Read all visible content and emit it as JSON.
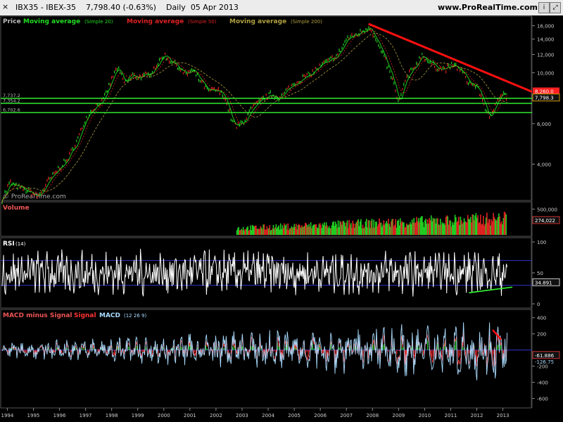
{
  "header": {
    "close_glyph": "×",
    "title": "IBX35 - IBEX-35",
    "last_price": "7,798.40",
    "change": "(-0.63%)",
    "period": "Daily",
    "date": "05 Apr 2013",
    "site": "www.ProRealTime.com",
    "btn_info": "i",
    "btn_expand": "⤢"
  },
  "price_panel": {
    "legend_price": "Price",
    "legend_ma20": "Moving average",
    "legend_ma20_params": "(Simple 20)",
    "legend_ma50": "Moving average",
    "legend_ma50_params": "(Simple 50)",
    "legend_ma200": "Moving average",
    "legend_ma200_params": "(Simple 200)",
    "watermark": "© ProRealTime.com",
    "level_labels": [
      "7,737.2",
      "7,354.2",
      "6,702.6"
    ],
    "last_tag_ma": "8,260.0",
    "last_tag_price": "7,798.3",
    "y_ticks": [
      "16,000",
      "14,000",
      "12,000",
      "10,000",
      "8,000",
      "6,000",
      "4,000"
    ]
  },
  "volume_panel": {
    "title": "Volume",
    "y_ticks": [
      "500,000"
    ],
    "last_tag": "274,022"
  },
  "rsi_panel": {
    "title": "RSI",
    "params": "(14)",
    "y_ticks": [
      "100",
      "50",
      "0"
    ],
    "last_tag": "34.891"
  },
  "macd_panel": {
    "title_hist": "MACD minus Signal",
    "title_signal": "Signal",
    "title_macd": "MACD",
    "params": "(12 26 9)",
    "y_ticks": [
      "400",
      "200",
      "-200",
      "-400",
      "-600"
    ],
    "last_tag_1": "-61.886",
    "last_tag_2": "-126.75"
  },
  "x_axis": {
    "labels": [
      "1994",
      "1995",
      "1996",
      "1997",
      "1998",
      "1999",
      "2000",
      "2001",
      "2002",
      "2003",
      "2004",
      "2005",
      "2006",
      "2007",
      "2008",
      "2009",
      "2010",
      "2011",
      "2012",
      "2013"
    ]
  },
  "colors": {
    "price_up": "#22cc22",
    "price_down": "#dd2222",
    "ma20": "#22dd22",
    "ma50": "#dd2222",
    "ma200": "#b0a040",
    "trendline": "#ff1010",
    "support": "#33ff33",
    "rsi": "#ffffff",
    "rsi_bands": "#3333cc",
    "macd": "#aaddff",
    "signal": "#ff4444"
  },
  "chart_data": [
    {
      "type": "line",
      "name": "price",
      "x": [
        1993.9,
        1994.2,
        1994.6,
        1995.0,
        1995.3,
        1995.7,
        1996.0,
        1996.4,
        1996.8,
        1997.1,
        1997.5,
        1997.8,
        1998.0,
        1998.3,
        1998.6,
        1998.9,
        1999.1,
        1999.5,
        1999.9,
        2000.1,
        2000.3,
        2000.6,
        2000.9,
        2001.2,
        2001.5,
        2001.8,
        2002.1,
        2002.4,
        2002.7,
        2002.9,
        2003.2,
        2003.5,
        2003.9,
        2004.2,
        2004.6,
        2004.9,
        2005.3,
        2005.7,
        2006.0,
        2006.4,
        2006.8,
        2007.1,
        2007.5,
        2007.8,
        2008.0,
        2008.3,
        2008.6,
        2008.9,
        2009.1,
        2009.4,
        2009.7,
        2010.0,
        2010.3,
        2010.6,
        2010.9,
        2011.2,
        2011.5,
        2011.8,
        2012.1,
        2012.4,
        2012.6,
        2012.9,
        2013.1,
        2013.26
      ],
      "values": [
        2800,
        3300,
        3150,
        3000,
        2900,
        3400,
        3750,
        4200,
        5100,
        6300,
        7200,
        7600,
        8800,
        10500,
        9000,
        9800,
        9500,
        9800,
        11000,
        12000,
        11400,
        10800,
        9800,
        10200,
        9200,
        8300,
        8400,
        8000,
        6200,
        5800,
        6200,
        7000,
        7700,
        8000,
        7800,
        8600,
        9300,
        9800,
        10500,
        11200,
        12000,
        14000,
        14700,
        15400,
        15800,
        13300,
        11200,
        9000,
        7300,
        9500,
        10500,
        12000,
        11000,
        10500,
        10400,
        10800,
        10200,
        9000,
        8700,
        7200,
        6200,
        7800,
        8200,
        7798
      ],
      "ylim": [
        2800,
        17000
      ],
      "ylog": true
    },
    {
      "type": "line",
      "name": "RSI (14)",
      "ylim": [
        0,
        100
      ],
      "bands": [
        70,
        30
      ],
      "last": 34.891
    },
    {
      "type": "bar",
      "name": "Volume",
      "last": 274022
    },
    {
      "type": "line",
      "name": "MACD (12 26 9)",
      "ylim": [
        -700,
        450
      ],
      "last": [
        -61.886,
        -126.75
      ]
    }
  ]
}
